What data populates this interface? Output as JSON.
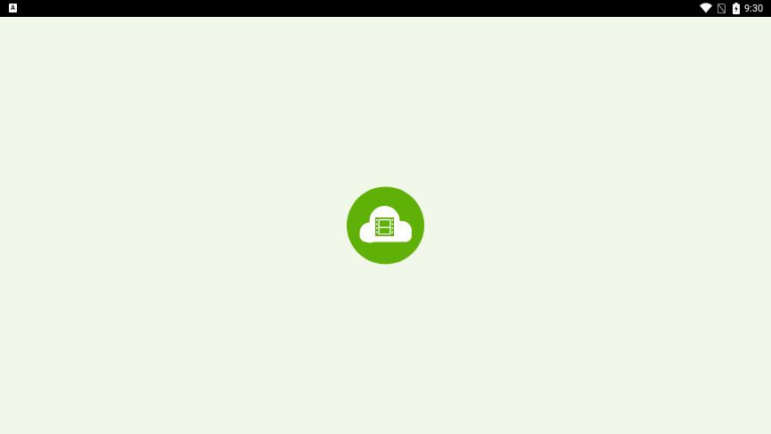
{
  "status_bar": {
    "notification_icon": "app-notification-icon",
    "notification_glyph": "A",
    "icons": [
      "wifi-icon",
      "no-sim-icon",
      "battery-charging-icon"
    ],
    "time": "9:30"
  },
  "splash": {
    "logo_icon": "cloud-film-icon",
    "logo_color": "#5fb108",
    "background_color": "#f2f8e9"
  }
}
